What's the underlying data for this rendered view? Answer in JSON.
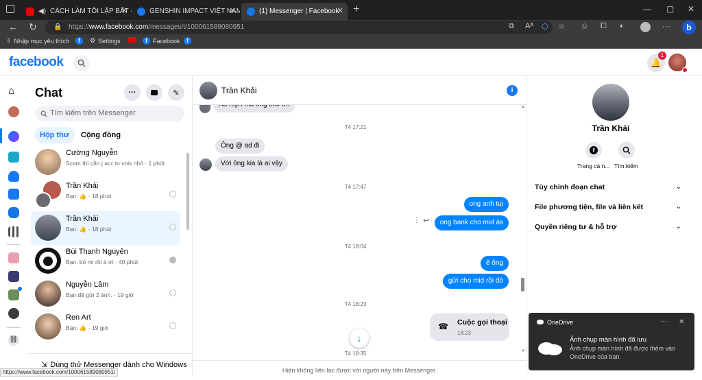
{
  "browser": {
    "tabs": [
      {
        "title": "CÁCH LÀM TÔI LẬP BẤT - N",
        "icon": "youtube-icon"
      },
      {
        "title": "GENSHIN IMPACT VIỆT NAM TRA",
        "icon": "facebook-icon"
      },
      {
        "title": "(1) Messenger | Facebook",
        "icon": "facebook-icon"
      }
    ],
    "url_prefix": "https://",
    "url_host": "www.facebook.com",
    "url_path": "/messages/t/100061589080951",
    "bookmarks": {
      "import_label": "Nhập mục yêu thích",
      "settings_label": "Settings",
      "facebook_label": "Facebook"
    }
  },
  "facebook": {
    "logo": "facebook",
    "notification_count": "1"
  },
  "chat": {
    "title": "Chat",
    "search_placeholder": "Tìm kiếm trên Messenger",
    "tabs": [
      "Hộp thư",
      "Cộng đồng"
    ],
    "conversations": [
      {
        "name": "Cường Nguyễn",
        "preview": "Scam thì cần j acc to vois nhỏ · 1 phút"
      },
      {
        "name": "Trần Khải",
        "preview": "Bạn: 👍 · 18 phút"
      },
      {
        "name": "Trần Khải",
        "preview": "Bạn: 👍 · 18 phút"
      },
      {
        "name": "Bùi Thanh Nguyên",
        "preview": "Bạn: bỏ mị rồi à ơi · 40 phút"
      },
      {
        "name": "Nguyễn Lâm",
        "preview": "Bạn đã gửi 2 ảnh. · 19 giờ"
      },
      {
        "name": "Ren Art",
        "preview": "Bạn: 👍 · 19 giờ"
      }
    ],
    "try_windows": "Dùng thử Messenger dành cho Windows"
  },
  "conversation": {
    "name": "Trần Khải",
    "messages": {
      "top_partial": "Ad rep l mà ông chx ơn",
      "ts1": "T4 17:21",
      "in1": "Ông @ ad đi",
      "in2": "Với ông kia là ai vậy",
      "ts2": "T4 17:47",
      "out1": "ong anh tui",
      "out2": "ong bank cho mid ás",
      "ts3": "T4 18:04",
      "out3": "ê ông",
      "out4": "gửi cho mid rồi đó",
      "ts4": "T4 18:23",
      "call_title": "Cuộc gọi thoại",
      "call_time": "18:23",
      "ts5": "T4 18:35"
    },
    "composer_notice": "Hiện không liên lạc được với người này trên Messenger."
  },
  "info_panel": {
    "name": "Trần Khải",
    "profile_label": "Trang cá n...",
    "search_label": "Tìm kiếm",
    "sections": [
      "Tùy chỉnh đoạn chat",
      "File phương tiện, file và liên kết",
      "Quyền riêng tư & hỗ trợ"
    ]
  },
  "toast": {
    "app": "OneDrive",
    "title": "Ảnh chụp màn hình đã lưu",
    "body": "Ảnh chụp màn hình đã được thêm vào OneDrive của bạn."
  },
  "status_url": "https://www.facebook.com/100061589080951/",
  "colors": {
    "brand": "#1877f2",
    "bubble_out": "#0084ff",
    "bubble_in": "#e4e6eb"
  }
}
